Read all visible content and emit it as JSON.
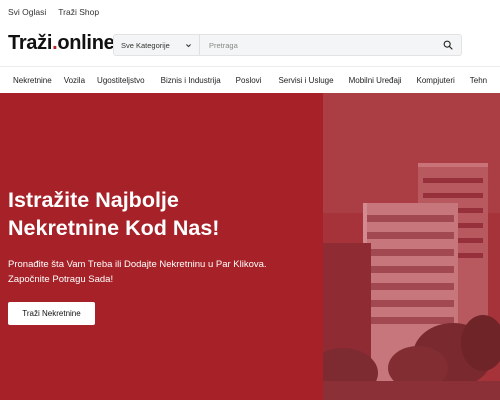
{
  "topbar": {
    "links": [
      "Svi Oglasi",
      "Traži Shop"
    ]
  },
  "logo": {
    "text_main": "Traži",
    "dot": ".",
    "text_end": "online"
  },
  "search": {
    "category_selected": "Sve Kategorije",
    "placeholder": "Pretraga"
  },
  "nav": {
    "items": [
      "Nekretnine",
      "Vozila",
      "Ugostiteljstvo",
      "Biznis i Industrija",
      "Poslovi",
      "Servisi i Usluge",
      "Mobilni Uređaji",
      "Kompjuteri",
      "Tehn"
    ]
  },
  "hero": {
    "title_line1": "Istražite Najbolje",
    "title_line2": "Nekretnine Kod Nas!",
    "subtitle_line1": "Pronađite šta Vam Treba ili Dodajte Nekretninu u Par Klikova.",
    "subtitle_line2": "Započnite Potragu Sada!",
    "button_label": "Traži Nekretnine"
  },
  "colors": {
    "brand_red": "#a72228",
    "logo_dot": "#b11f24"
  },
  "icons": {
    "dropdown": "chevron-down-icon",
    "search": "search-icon"
  }
}
